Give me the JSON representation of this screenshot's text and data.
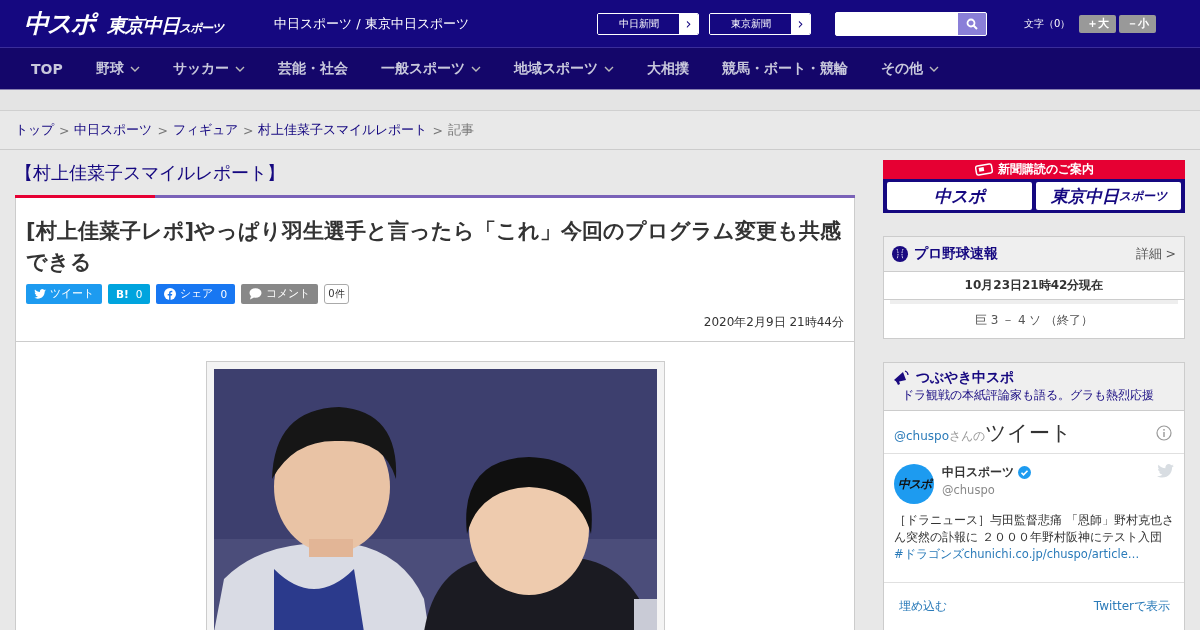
{
  "header": {
    "logo_main": "中スポ",
    "logo_tokyo": "東京中日",
    "logo_tokyo_small": "スポーツ",
    "site_name": "中日スポーツ / 東京中日スポーツ",
    "paper_links": [
      {
        "label": "中日新聞",
        "arrow": "›"
      },
      {
        "label": "東京新聞",
        "arrow": "›"
      }
    ],
    "font_size": {
      "label": "文字（0）",
      "buttons": [
        "＋大",
        "－小"
      ]
    }
  },
  "nav": [
    {
      "label": "TOP",
      "dropdown": false
    },
    {
      "label": "野球",
      "dropdown": true
    },
    {
      "label": "サッカー",
      "dropdown": true
    },
    {
      "label": "芸能・社会",
      "dropdown": false
    },
    {
      "label": "一般スポーツ",
      "dropdown": true
    },
    {
      "label": "地域スポーツ",
      "dropdown": true
    },
    {
      "label": "大相撲",
      "dropdown": false
    },
    {
      "label": "競馬・ボート・競輪",
      "dropdown": false
    },
    {
      "label": "その他",
      "dropdown": true
    }
  ],
  "breadcrumb": {
    "links": [
      "トップ",
      "中日スポーツ",
      "フィギュア",
      "村上佳菜子スマイルレポート"
    ],
    "current": "記事",
    "separator": ">"
  },
  "section_title": "【村上佳菜子スマイルレポート】",
  "article": {
    "title": "[村上佳菜子レポ]やっぱり羽生選手と言ったら「これ」今回のプログラム変更も共感できる",
    "share": [
      {
        "kind": "twitter",
        "label": "ツイート"
      },
      {
        "kind": "hatena",
        "label": "B!",
        "count": "0"
      },
      {
        "kind": "facebook",
        "label": "シェア",
        "count": "0"
      },
      {
        "kind": "comment",
        "label": "コメント"
      }
    ],
    "comment_count": "0件",
    "date": "2020年2月9日 21時44分"
  },
  "sidebar": {
    "subscribe": {
      "title": "新聞購読のご案内",
      "logos": [
        "中スポ",
        "東京中日"
      ],
      "logo_small": "スポーツ"
    },
    "baseball": {
      "title": "プロ野球速報",
      "more": "詳細 >",
      "updated": "10月23日21時42分現在",
      "score": "巨 3 － 4 ソ （終了）"
    },
    "tweets": {
      "title": "つぶやき中スポ",
      "subtitle": "ドラ観戦の本紙評論家も語る。グラも熱烈応援",
      "handle_prefix": "@chuspo",
      "handle_suffix": "さんの",
      "heading": "ツイート",
      "tweet": {
        "avatar": "中スポ",
        "name": "中日スポーツ",
        "verified": true,
        "handle": "@chuspo",
        "text": "［ドラニュース］与田監督悲痛 「恩師」野村克也さん突然の訃報に ２０００年野村阪神にテスト入団",
        "hashtag": "#ドラゴンズ",
        "link": "chunichi.co.jp/chuspo/article…"
      },
      "embed": "埋め込む",
      "view_on": "Twitterで表示"
    }
  }
}
